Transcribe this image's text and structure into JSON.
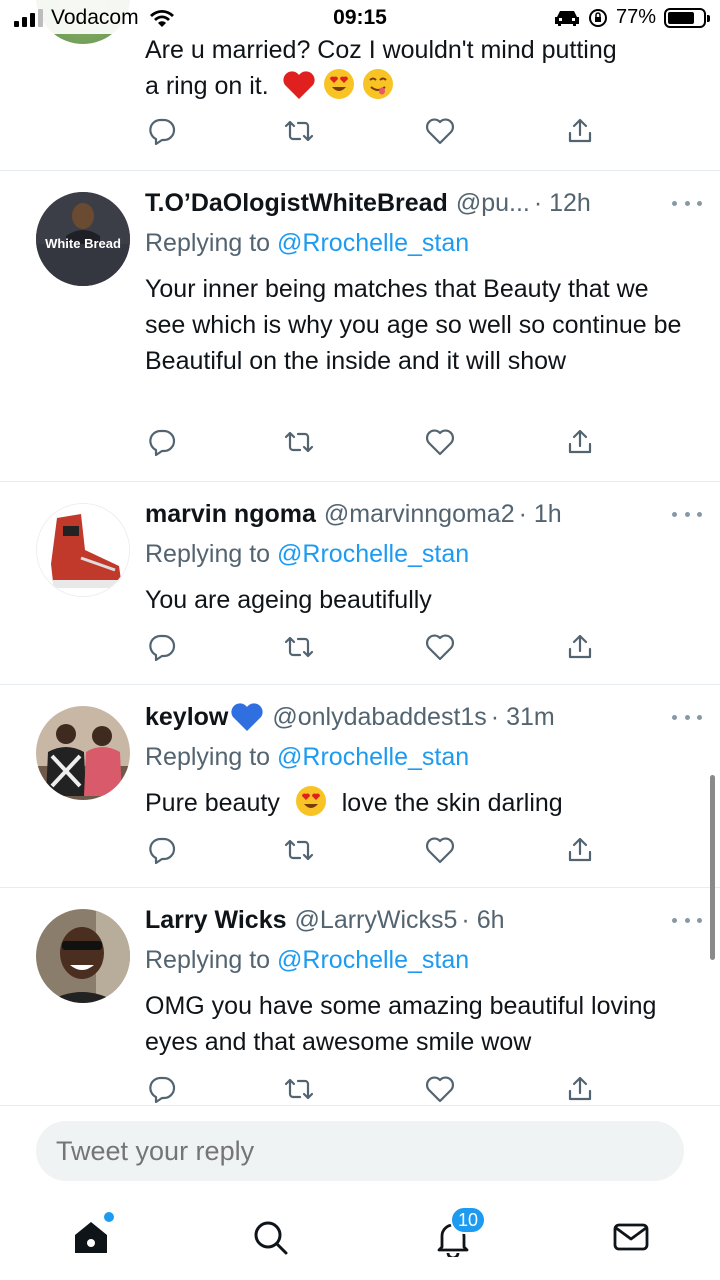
{
  "status_bar": {
    "carrier": "Vodacom",
    "time": "09:15",
    "battery": "77%",
    "battery_level": 0.77
  },
  "tweets": [
    {
      "name": "",
      "handle": "",
      "time": "",
      "replying_prefix": "",
      "replying_to": "",
      "text_lines": [
        "Are u married? Coz I wouldn't mind putting",
        "a ring on it."
      ]
    },
    {
      "name": "T.O’DaOlogistWhiteBread",
      "handle": "@pu...",
      "time": "· 12h",
      "replying_prefix": "Replying to ",
      "replying_to": "@Rrochelle_stan",
      "avatar_text": "White Bread",
      "text": "Your inner being matches that Beauty that we see which is why you age so well so continue be Beautiful on the inside and it will show"
    },
    {
      "name": "marvin ngoma",
      "handle": "@marvinngoma2",
      "time": "· 1h",
      "replying_prefix": "Replying to ",
      "replying_to": "@Rrochelle_stan",
      "text": "You are ageing beautifully"
    },
    {
      "name": "keylow",
      "handle": "@onlydabaddest1s",
      "time": "· 31m",
      "replying_prefix": "Replying to ",
      "replying_to": "@Rrochelle_stan",
      "text_a": "Pure beauty",
      "text_b": "love the skin darling"
    },
    {
      "name": "Larry Wicks",
      "handle": "@LarryWicks5",
      "time": "· 6h",
      "replying_prefix": "Replying to ",
      "replying_to": "@Rrochelle_stan",
      "text": "OMG you have some amazing beautiful loving eyes and that awesome smile wow"
    }
  ],
  "reply_bar": {
    "placeholder": "Tweet your reply"
  },
  "tabbar": {
    "notifications_badge": "10"
  },
  "colors": {
    "accent": "#1d9bf0",
    "secondary_text": "#536471",
    "divider": "#e6ecf0"
  },
  "icons": [
    "reply-icon",
    "retweet-icon",
    "like-icon",
    "share-icon",
    "more-icon",
    "home-icon",
    "search-icon",
    "bell-icon",
    "mail-icon"
  ]
}
